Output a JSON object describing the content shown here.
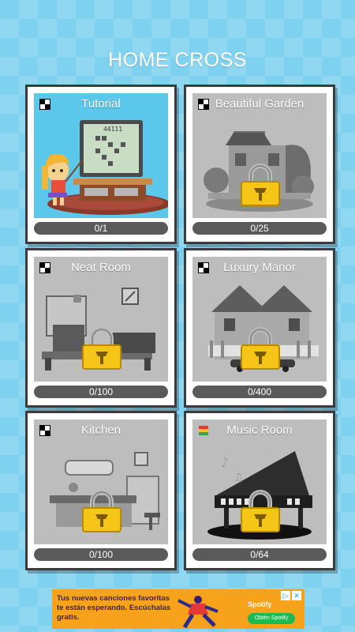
{
  "header": {
    "title": "HOME CROSS"
  },
  "cards": [
    {
      "name": "Tutorial",
      "progress": "0/1",
      "icon": "grid-icon",
      "locked": false
    },
    {
      "name": "Beautiful Garden",
      "progress": "0/25",
      "icon": "grid-icon",
      "locked": true
    },
    {
      "name": "Neat Room",
      "progress": "0/100",
      "icon": "grid-icon",
      "locked": true
    },
    {
      "name": "Luxury Manor",
      "progress": "0/400",
      "icon": "grid-icon",
      "locked": true
    },
    {
      "name": "Kitchen",
      "progress": "0/100",
      "icon": "grid-icon",
      "locked": true
    },
    {
      "name": "Music Room",
      "progress": "0/64",
      "icon": "color-grid-icon",
      "locked": true
    }
  ],
  "tutorial_board": {
    "numbers": "44111"
  },
  "ad": {
    "text": "Tus nuevas canciones favoritas te están esperando. Escúchalas gratis.",
    "brand": "Spotify",
    "cta": "Obtén Spotify"
  },
  "colors": {
    "background": "#7fd1f0",
    "lock": "#f5c518",
    "progress_bar": "#5a5a5a"
  }
}
